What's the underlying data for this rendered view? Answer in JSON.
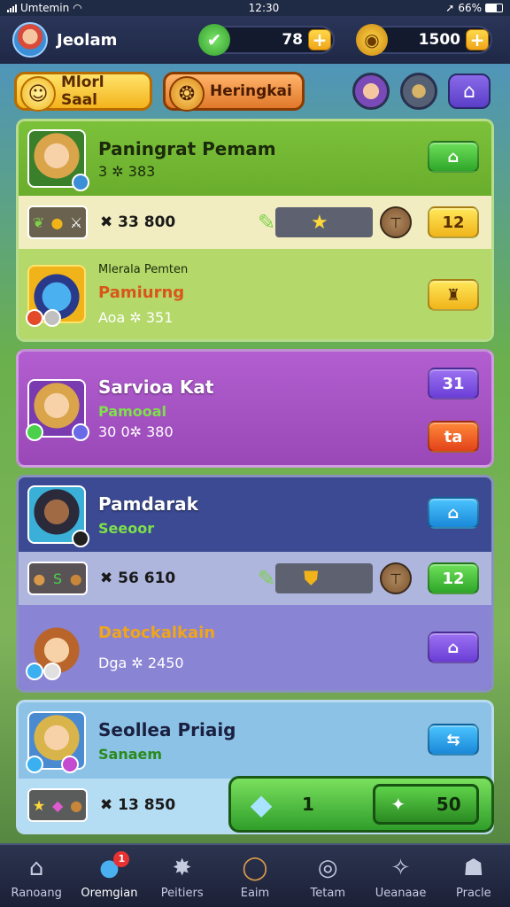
{
  "status": {
    "carrier": "Umtemin",
    "time": "12:30",
    "battery": "66%"
  },
  "header": {
    "player_name": "Jeolam",
    "gems": "78",
    "coins": "1500"
  },
  "pills": [
    {
      "label": "Mlorl Saal"
    },
    {
      "label": "Heringkai"
    }
  ],
  "cards": [
    {
      "title": "Paningrat Pemam",
      "stat": "3 ✲ 383",
      "btn": "⌂",
      "item_text": "✖ 33 800",
      "item_btn": "12",
      "sub_title": "Mlerala Pemten",
      "sub_name": "Pamiurng",
      "sub_stat": "Aoa ✲ 351",
      "sub_btn": "♜"
    },
    {
      "title": "Sarvioa Kat",
      "subtitle": "Pamooal",
      "stat": "30 0✲ 380",
      "btn_top": "31",
      "btn_bottom": "ta"
    },
    {
      "title": "Pamdarak",
      "subtitle": "Seeoor",
      "btn": "⌂",
      "item_text": "✖ 56 610",
      "item_btn": "12",
      "sub_name": "Datockalkain",
      "sub_stat": "Dga ✲ 2450",
      "sub_btn": "⌂"
    },
    {
      "title": "Seollea Priaig",
      "subtitle": "Sanaem",
      "btn": "⇆",
      "item_text": "✖ 13 850"
    }
  ],
  "popup": {
    "amount": "1",
    "price": "50"
  },
  "nav": [
    {
      "label": "Ranoang",
      "icon": "home-icon"
    },
    {
      "label": "Oremgian",
      "icon": "orb-icon",
      "badge": "1"
    },
    {
      "label": "Peitiers",
      "icon": "puzzle-icon"
    },
    {
      "label": "Eaim",
      "icon": "ring-icon"
    },
    {
      "label": "Tetam",
      "icon": "dial-icon"
    },
    {
      "label": "Ueanaae",
      "icon": "wand-icon"
    },
    {
      "label": "Pracle",
      "icon": "profile-icon"
    }
  ],
  "colors": {
    "card1": "#8fcf4a",
    "card2": "#b35bc8",
    "card3": "#3f4f9a",
    "card4": "#8fc3e4"
  }
}
